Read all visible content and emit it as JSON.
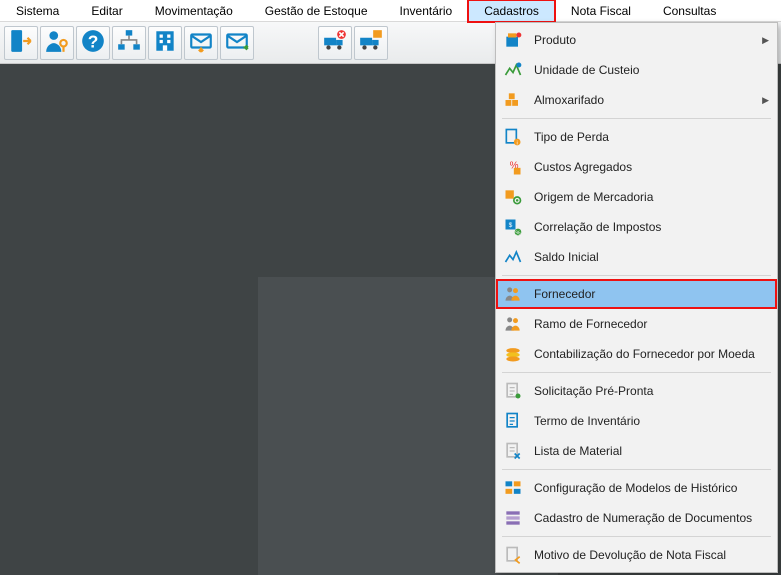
{
  "menubar": [
    {
      "label": "Sistema"
    },
    {
      "label": "Editar"
    },
    {
      "label": "Movimentação"
    },
    {
      "label": "Gestão de Estoque"
    },
    {
      "label": "Inventário"
    },
    {
      "label": "Cadastros"
    },
    {
      "label": "Nota Fiscal"
    },
    {
      "label": "Consultas"
    }
  ],
  "active_menu": "Cadastros",
  "dropdown": [
    {
      "label": "Produto",
      "submenu": true
    },
    {
      "label": "Unidade de Custeio"
    },
    {
      "label": "Almoxarifado",
      "submenu": true
    },
    {
      "label": "Tipo de Perda"
    },
    {
      "label": "Custos Agregados"
    },
    {
      "label": "Origem de Mercadoria"
    },
    {
      "label": "Correlação de Impostos"
    },
    {
      "label": "Saldo Inicial"
    },
    {
      "label": "Fornecedor",
      "highlighted": true,
      "hovered": true
    },
    {
      "label": "Ramo de Fornecedor"
    },
    {
      "label": "Contabilização do Fornecedor por Moeda"
    },
    {
      "label": "Solicitação Pré-Pronta"
    },
    {
      "label": "Termo de Inventário"
    },
    {
      "label": "Lista de Material"
    },
    {
      "label": "Configuração de Modelos de Histórico"
    },
    {
      "label": "Cadastro de Numeração de Documentos"
    },
    {
      "label": "Motivo de Devolução de Nota Fiscal"
    }
  ],
  "toolbar_icons_group1": [
    "door-exit",
    "user-key",
    "help",
    "org-chart",
    "building",
    "mail-in",
    "mail-out"
  ],
  "toolbar_icons_group2": [
    "truck-cancel",
    "truck-box"
  ],
  "colors": {
    "accent_blue": "#1284c7",
    "accent_orange": "#f29b1f",
    "hover_blue": "#8fc4f0",
    "highlight_red": "#e11",
    "workspace_bg": "#3f4445"
  }
}
